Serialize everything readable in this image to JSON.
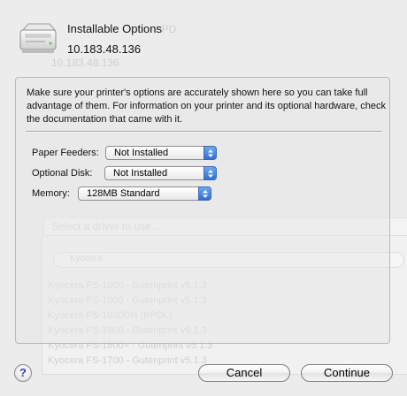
{
  "sheet": {
    "title": "Installable Options",
    "address": "10.183.48.136",
    "description": "Make sure your printer's options are accurately shown here so you can take full advantage of them.  For information on your printer and its optional hardware, check the documentation that came with it."
  },
  "options": {
    "paper_feeders": {
      "label": "Paper Feeders:",
      "value": "Not Installed"
    },
    "optional_disk": {
      "label": "Optional Disk:",
      "value": "Not Installed"
    },
    "memory": {
      "label": "Memory:",
      "value": "128MB Standard"
    }
  },
  "buttons": {
    "help": "?",
    "cancel": "Cancel",
    "continue": "Continue"
  },
  "background_window": {
    "queue_name_fragment": "LPD",
    "address": "10.183.48.136",
    "driver_placeholder": "Select a driver to use...",
    "search_text": "Kyocera",
    "drivers": [
      "Kyocera FS-1000 - Gutenprint v5.1.3",
      "Kyocera FS-1000 - Gutenprint v5.1.3",
      "Kyocera FS-1030DN (KPDL)",
      "Kyocera FS-1800 - Gutenprint v5.1.3",
      "Kyocera FS-1800+ - Gutenprint v5.1.3",
      "Kyocera FS-1700 - Gutenprint v5.1.3"
    ]
  },
  "colors": {
    "accent": "#3275dd",
    "sheet_background": "#ececec"
  }
}
